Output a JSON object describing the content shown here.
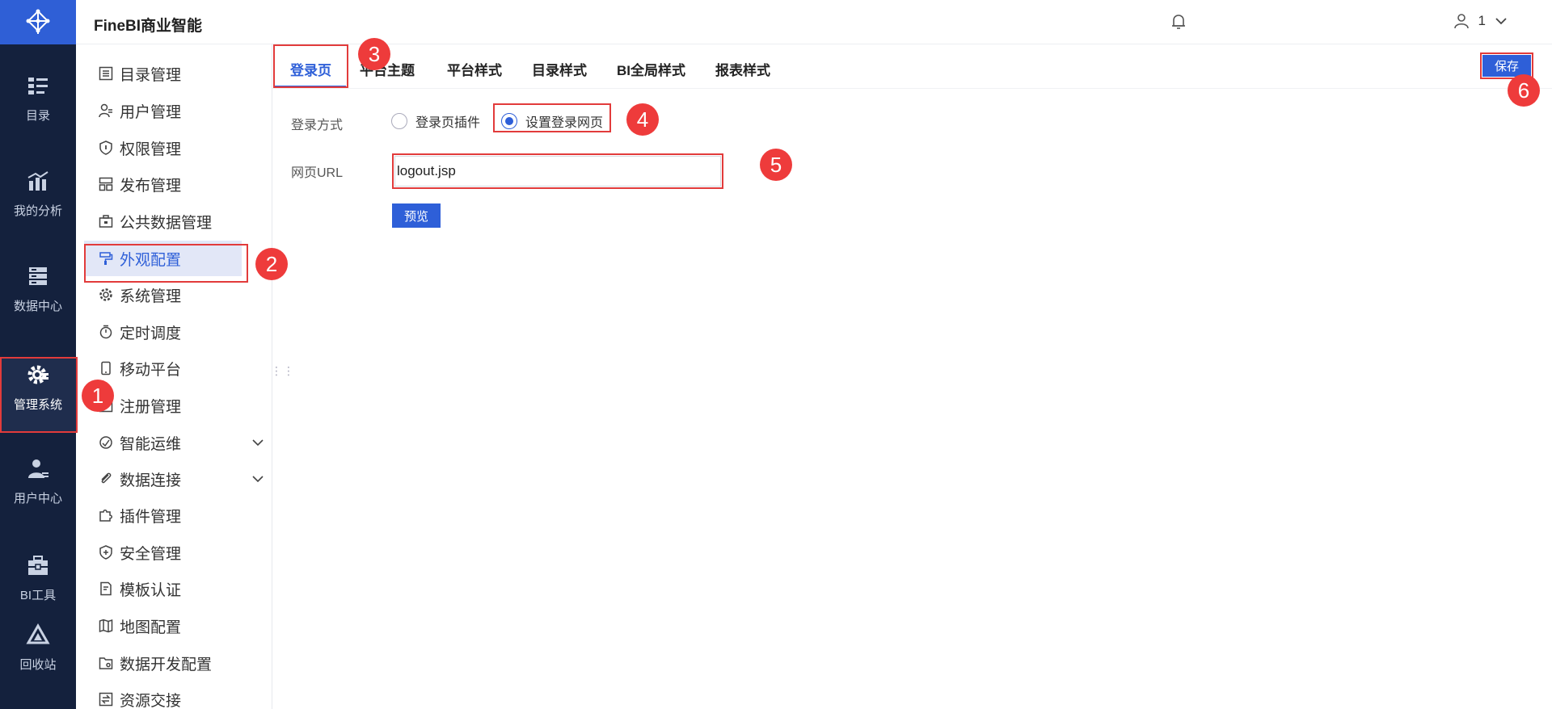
{
  "app": {
    "title": "FineBI商业智能",
    "user_label": "1"
  },
  "leftnav": [
    {
      "label": "目录",
      "icon": "catalog-icon"
    },
    {
      "label": "我的分析",
      "icon": "analysis-icon"
    },
    {
      "label": "数据中心",
      "icon": "database-icon"
    },
    {
      "label": "管理系统",
      "icon": "gear-icon",
      "active": true
    },
    {
      "label": "用户中心",
      "icon": "user-icon"
    },
    {
      "label": "BI工具",
      "icon": "toolbox-icon"
    },
    {
      "label": "回收站",
      "icon": "recycle-icon"
    }
  ],
  "sidebar": {
    "items": [
      {
        "label": "目录管理"
      },
      {
        "label": "用户管理"
      },
      {
        "label": "权限管理"
      },
      {
        "label": "发布管理"
      },
      {
        "label": "公共数据管理"
      },
      {
        "label": "外观配置",
        "active": true
      },
      {
        "label": "系统管理"
      },
      {
        "label": "定时调度"
      },
      {
        "label": "移动平台"
      },
      {
        "label": "注册管理"
      },
      {
        "label": "智能运维",
        "expandable": true
      },
      {
        "label": "数据连接",
        "expandable": true
      },
      {
        "label": "插件管理"
      },
      {
        "label": "安全管理"
      },
      {
        "label": "模板认证"
      },
      {
        "label": "地图配置"
      },
      {
        "label": "数据开发配置"
      },
      {
        "label": "资源交接"
      }
    ]
  },
  "tabs": [
    {
      "label": "登录页",
      "active": true
    },
    {
      "label": "平台主题"
    },
    {
      "label": "平台样式"
    },
    {
      "label": "目录样式"
    },
    {
      "label": "BI全局样式"
    },
    {
      "label": "报表样式"
    }
  ],
  "toolbar": {
    "save_label": "保存"
  },
  "form": {
    "login_method_label": "登录方式",
    "option_plugin": "登录页插件",
    "option_custom": "设置登录网页",
    "selected": "设置登录网页",
    "url_label": "网页URL",
    "url_value": "logout.jsp",
    "preview_label": "预览"
  },
  "annotations": [
    "1",
    "2",
    "3",
    "4",
    "5",
    "6"
  ],
  "colors": {
    "accent": "#2e5fd8",
    "nav_bg": "#14213d",
    "highlight": "#e23b3b"
  }
}
